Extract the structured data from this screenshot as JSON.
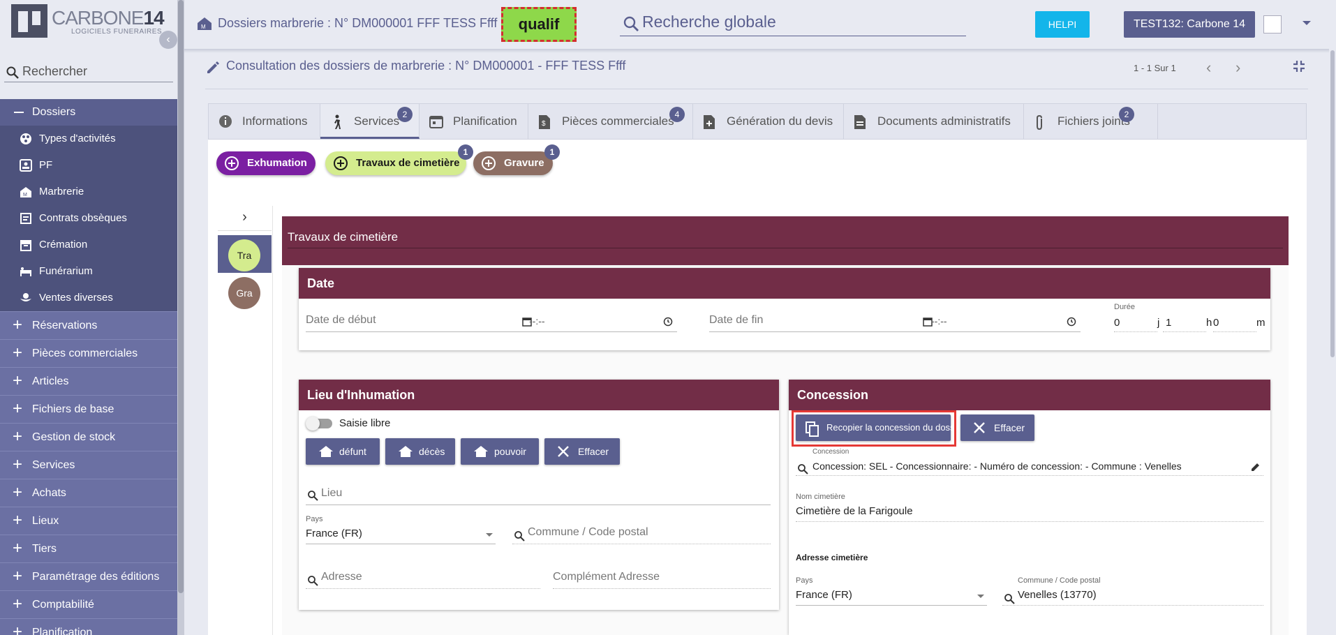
{
  "app": {
    "brand": "CARBONE",
    "brand_num": "14",
    "brand_sub": "LOGICIELS FUNERAIRES"
  },
  "sidebar": {
    "search_placeholder": "Rechercher",
    "open_section": "Dossiers",
    "sub_items": [
      {
        "label": "Types d'activités",
        "icon": "activity-types-icon"
      },
      {
        "label": "PF",
        "icon": "id-card-icon"
      },
      {
        "label": "Marbrerie",
        "icon": "marbrerie-icon"
      },
      {
        "label": "Contrats obsèques",
        "icon": "contract-icon"
      },
      {
        "label": "Crémation",
        "icon": "archive-icon"
      },
      {
        "label": "Funérarium",
        "icon": "bed-icon"
      },
      {
        "label": "Ventes diverses",
        "icon": "flower-icon"
      }
    ],
    "sections": [
      "Réservations",
      "Pièces commerciales",
      "Articles",
      "Fichiers de base",
      "Gestion de stock",
      "Services",
      "Achats",
      "Lieux",
      "Tiers",
      "Paramétrage des éditions",
      "Comptabilité",
      "Planification"
    ]
  },
  "topbar": {
    "dossier_title": "Dossiers marbrerie : N° DM000001 FFF TESS Ffff",
    "env_badge": "qualif",
    "global_search_placeholder": "Recherche globale",
    "help_label": "HELPI",
    "user_label": "TEST132: Carbone 14"
  },
  "consultation": {
    "title": "Consultation des dossiers de marbrerie : N° DM000001 - FFF TESS Ffff",
    "pager": "1 - 1 Sur 1"
  },
  "tabs": [
    {
      "label": "Informations",
      "icon": "info-icon",
      "badge": ""
    },
    {
      "label": "Services",
      "icon": "person-walking-icon",
      "badge": "2"
    },
    {
      "label": "Planification",
      "icon": "calendar-icon",
      "badge": ""
    },
    {
      "label": "Pièces commerciales",
      "icon": "invoice-icon",
      "badge": "4"
    },
    {
      "label": "Génération du devis",
      "icon": "file-add-icon",
      "badge": ""
    },
    {
      "label": "Documents administratifs",
      "icon": "document-icon",
      "badge": ""
    },
    {
      "label": "Fichiers joints",
      "icon": "paperclip-icon",
      "badge": "2"
    }
  ],
  "services": {
    "chips": [
      {
        "label": "Exhumation",
        "badge": "",
        "color": "#7b1fa2"
      },
      {
        "label": "Travaux de cimetière",
        "badge": "1",
        "color": "#d4ec8e"
      },
      {
        "label": "Gravure",
        "badge": "1",
        "color": "#8d6e63"
      }
    ],
    "mini_items": [
      {
        "label": "Tra",
        "color": "#d4ec8e"
      },
      {
        "label": "Gra",
        "color": "#8d6e63"
      }
    ],
    "panel_title": "Travaux de cimetière"
  },
  "date_card": {
    "title": "Date",
    "start_placeholder": "Date de début",
    "start_time": "--:--",
    "end_placeholder": "Date de fin",
    "end_time": "--:--",
    "duration_label": "Durée",
    "duration_days": "0",
    "unit_days": "j",
    "duration_hours": "1",
    "unit_hours": "h",
    "duration_minutes": "0",
    "unit_minutes": "m"
  },
  "lieu_card": {
    "title": "Lieu d'Inhumation",
    "free_entry_label": "Saisie libre",
    "buttons": [
      "défunt",
      "décès",
      "pouvoir",
      "Effacer"
    ],
    "lieu_placeholder": "Lieu",
    "pays_label": "Pays",
    "pays_value": "France (FR)",
    "commune_placeholder": "Commune / Code postal",
    "adresse_placeholder": "Adresse",
    "complement_placeholder": "Complément Adresse"
  },
  "concession_card": {
    "title": "Concession",
    "copy_button": "Recopier la concession du dossier",
    "clear_button": "Effacer",
    "concession_label": "Concession",
    "concession_value": "Concession: SEL - Concessionnaire:   - Numéro de concession:  - Commune : Venelles",
    "cemetery_label": "Nom cimetière",
    "cemetery_value": "Cimetière de la Farigoule",
    "address_heading": "Adresse cimetière",
    "pays_label": "Pays",
    "pays_value": "France (FR)",
    "commune_label": "Commune / Code postal",
    "commune_value": "Venelles (13770)"
  }
}
